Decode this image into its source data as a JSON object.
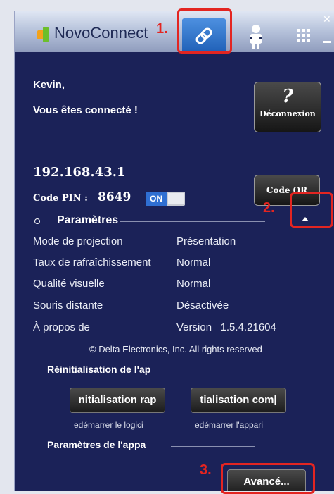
{
  "app": {
    "title_bold": "Novo",
    "title_thin": "Connect"
  },
  "annotations": [
    "1.",
    "2.",
    "3."
  ],
  "greeting": {
    "name": "Kevin,",
    "status": "Vous êtes connecté !"
  },
  "disconnect_button": {
    "icon": "?",
    "label": "Déconnexion"
  },
  "connection": {
    "ip": "192.168.43.1",
    "pin_label": "Code PIN :",
    "pin_value": "8649",
    "toggle_label": "ON",
    "qr_button": "Code QR"
  },
  "settings": {
    "heading": "Paramètres",
    "rows": [
      {
        "label": "Mode de projection",
        "value": "Présentation"
      },
      {
        "label": "Taux de rafraîchissement",
        "value": "Normal"
      },
      {
        "label": "Qualité visuelle",
        "value": "Normal"
      },
      {
        "label": "Souris distante",
        "value": "Désactivée"
      },
      {
        "label": "À propos de",
        "value": "Version   1.5.4.21604"
      }
    ],
    "copyright": "© Delta Electronics, Inc. All rights reserved"
  },
  "reset": {
    "heading": "Réinitialisation de l'ap",
    "quick_button": "nitialisation rap",
    "quick_caption": "edémarrer le logici",
    "full_button": "tialisation com|",
    "full_caption": "edémarrer l'appari"
  },
  "device_settings": {
    "heading": "Paramètres de l'appa",
    "advanced_button": "Avancé..."
  },
  "icons": [
    "link-icon",
    "users-icon",
    "grid-icon",
    "close-icon",
    "chevron-up-icon",
    "settings-dot-icon"
  ],
  "colors": {
    "panel": "#1b2258",
    "annotation": "#e32521",
    "toggle_on": "#2f6fd2"
  }
}
